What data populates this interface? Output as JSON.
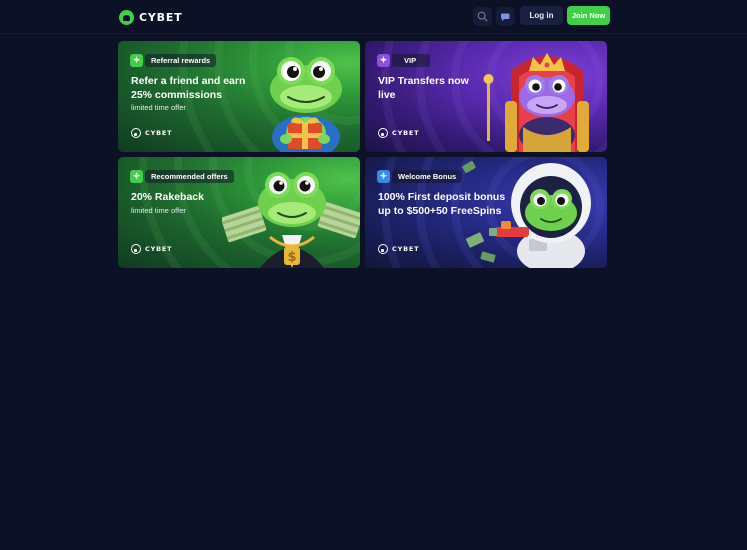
{
  "header": {
    "brand": "CYBET",
    "search_icon": "search-icon",
    "chat_icon": "chat-icon",
    "login_label": "Log in",
    "join_label": "Join Now"
  },
  "colors": {
    "page_bg": "#0d1126",
    "accent_green": "#3fcf4a",
    "login_bg": "#1a2140"
  },
  "promos": [
    {
      "badge": "Referral rewards",
      "badge_icon": "sparkle-icon",
      "title": "Refer a friend and earn 25% commissions",
      "subtitle": "limited time offer",
      "brand": "CYBET",
      "art": "frog-with-gift"
    },
    {
      "badge": "VIP",
      "badge_icon": "sparkle-icon",
      "title": "VIP Transfers now live",
      "subtitle": "",
      "brand": "CYBET",
      "art": "frog-king-on-throne"
    },
    {
      "badge": "Recommended offers",
      "badge_icon": "sparkle-icon",
      "title": "20% Rakeback",
      "subtitle": "limited time offer",
      "brand": "CYBET",
      "art": "frog-with-money"
    },
    {
      "badge": "Welcome Bonus",
      "badge_icon": "sparkle-icon",
      "title": "100% First deposit bonus up to $500+50 FreeSpins",
      "subtitle": "",
      "brand": "CYBET",
      "art": "frog-astronaut"
    }
  ]
}
